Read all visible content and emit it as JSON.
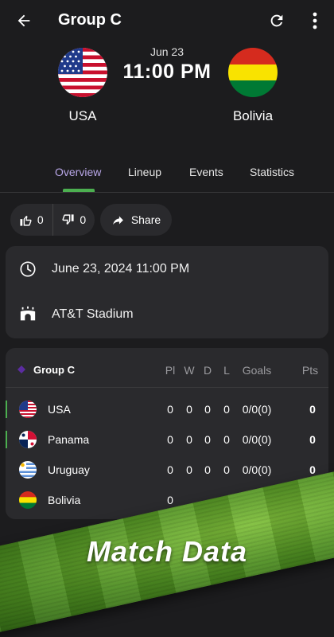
{
  "header": {
    "title": "Group C",
    "back_icon": "arrow-left-icon",
    "refresh_icon": "refresh-icon",
    "more_icon": "more-vert-icon"
  },
  "match": {
    "date_short": "Jun 23",
    "time": "11:00 PM",
    "home": {
      "name": "USA",
      "flag": "usa-flag"
    },
    "away": {
      "name": "Bolivia",
      "flag": "bolivia-flag"
    }
  },
  "tabs": [
    {
      "label": "Overview",
      "active": true
    },
    {
      "label": "Lineup",
      "active": false
    },
    {
      "label": "Events",
      "active": false
    },
    {
      "label": "Statistics",
      "active": false
    }
  ],
  "actions": {
    "likes": "0",
    "dislikes": "0",
    "share_label": "Share"
  },
  "info": {
    "datetime": "June 23, 2024 11:00 PM",
    "venue": "AT&T Stadium"
  },
  "standings": {
    "group": "Group C",
    "columns": [
      "Pl",
      "W",
      "D",
      "L",
      "Goals",
      "Pts"
    ],
    "rows": [
      {
        "team": "USA",
        "pl": "0",
        "w": "0",
        "d": "0",
        "l": "0",
        "goals": "0/0(0)",
        "pts": "0"
      },
      {
        "team": "Panama",
        "pl": "0",
        "w": "0",
        "d": "0",
        "l": "0",
        "goals": "0/0(0)",
        "pts": "0"
      },
      {
        "team": "Uruguay",
        "pl": "0",
        "w": "0",
        "d": "0",
        "l": "0",
        "goals": "0/0(0)",
        "pts": "0"
      },
      {
        "team": "Bolivia",
        "pl": "0",
        "w": "",
        "d": "",
        "l": "",
        "goals": "",
        "pts": ""
      }
    ]
  },
  "banner": {
    "text": "Match Data"
  },
  "colors": {
    "background": "#1c1c1e",
    "card": "#2a2a2d",
    "accent_tab": "#b9a7e8",
    "indicator": "#4caf50",
    "group_dot": "#5b2ca0"
  }
}
